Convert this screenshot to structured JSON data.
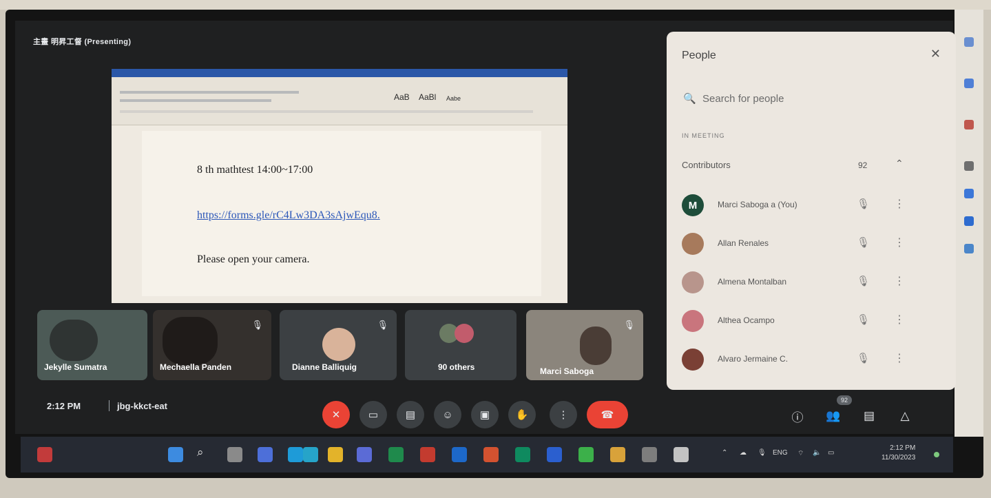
{
  "meeting": {
    "presenter_label": "主畫  明昇工督 (Presenting)",
    "time": "2:12 PM",
    "code": "jbg-kkct-eat",
    "participants_badge": "92"
  },
  "document": {
    "ribbon_styles": [
      "AaB",
      "AaBl",
      "Aabe"
    ],
    "lines": [
      "8 th mathtest 14:00~17:00",
      "https://forms.gle/rC4Lw3DA3sAjwEqu8.",
      "Please open your camera."
    ]
  },
  "tiles": [
    {
      "name": "Jekylle Sumatra"
    },
    {
      "name": "Mechaella Panden"
    },
    {
      "name": "Dianne Balliquig"
    },
    {
      "name": "90 others"
    },
    {
      "name": "Marci Saboga"
    }
  ],
  "people_panel": {
    "title": "People",
    "search_placeholder": "Search for people",
    "section": "IN MEETING",
    "group": "Contributors",
    "group_count": "92",
    "participants": [
      {
        "name": "Marci Saboga a (You)",
        "initial": "M",
        "color": "#1e4d3a"
      },
      {
        "name": "Allan Renales",
        "initial": "",
        "color": "#a77a5c"
      },
      {
        "name": "Almena Montalban",
        "initial": "",
        "color": "#b8958c"
      },
      {
        "name": "Althea Ocampo",
        "initial": "",
        "color": "#c9757d"
      },
      {
        "name": "Alvaro Jermaine C.",
        "initial": "",
        "color": "#7a4035"
      }
    ]
  },
  "taskbar": {
    "language": "ENG",
    "clock_time": "2:12 PM",
    "clock_date": "11/30/2023"
  },
  "colors": {
    "meet_bg": "#1f2021",
    "end_call": "#ea4335",
    "panel_bg": "#ece7e0",
    "link": "#2a56b8"
  }
}
